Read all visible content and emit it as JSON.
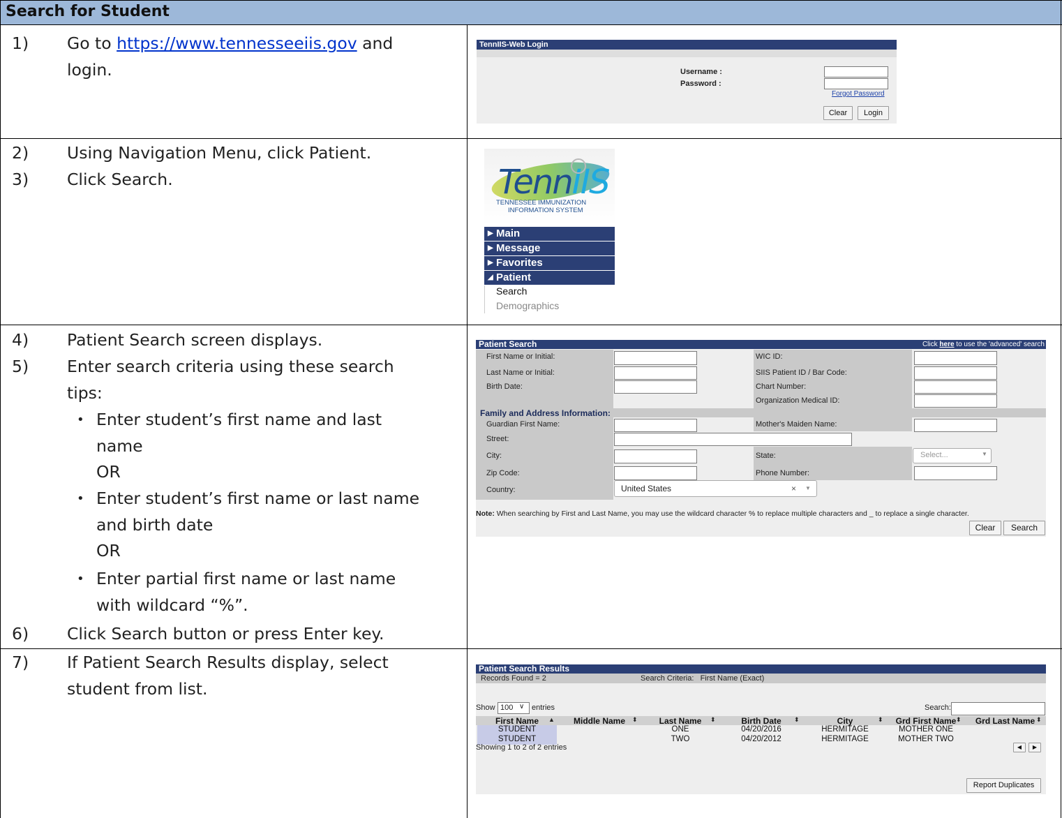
{
  "header": {
    "title": "Search for Student"
  },
  "steps": [
    {
      "num": "1)",
      "text_before_link": "Go to ",
      "link": "https://www.tennesseeiis.gov",
      "text_after_link": " and",
      "line2": "login."
    },
    {
      "num": "2)",
      "text": "Using Navigation Menu, click Patient."
    },
    {
      "num": "3)",
      "text": "Click Search."
    },
    {
      "num": "4)",
      "text": "Patient Search screen displays."
    },
    {
      "num": "5)",
      "line1": "Enter search criteria using these search",
      "line2": "tips:"
    },
    {
      "num": "6)",
      "text": "Click Search button or press Enter key."
    },
    {
      "num": "7)",
      "line1": "If Patient Search Results display, select",
      "line2": "student from list."
    }
  ],
  "tips": [
    {
      "line1": "Enter student’s first name and last",
      "line2": "name",
      "sep": "OR"
    },
    {
      "line1": "Enter student’s first name or last name",
      "line2": "and birth date",
      "sep": "OR"
    },
    {
      "line1": "Enter partial first name or last name",
      "line2": "with wildcard “%”."
    }
  ],
  "login": {
    "title": "TennIIS-Web Login",
    "username_label": "Username :",
    "password_label": "Password :",
    "forgot": "Forgot Password",
    "clear": "Clear",
    "login": "Login"
  },
  "nav": {
    "logo_text": "Tenn",
    "logo_suffix": "IIS",
    "logo_line1": "TENNESSEE IMMUNIZATION",
    "logo_line2": "INFORMATION SYSTEM",
    "items": [
      "Main",
      "Message",
      "Favorites",
      "Patient"
    ],
    "sub_items": [
      "Search",
      "Demographics"
    ]
  },
  "patient_search": {
    "title": "Patient Search",
    "advanced_prefix": "Click ",
    "advanced_link": "here",
    "advanced_suffix": " to use the 'advanced' search",
    "first_name": "First Name or Initial:",
    "last_name": "Last Name or Initial:",
    "birth_date": "Birth Date:",
    "wic": "WIC ID:",
    "siis": "SIIS Patient ID / Bar Code:",
    "chart": "Chart Number:",
    "org": "Organization Medical ID:",
    "family_header": "Family and Address Information:",
    "guardian": "Guardian First Name:",
    "maiden": "Mother's Maiden Name:",
    "street": "Street:",
    "city": "City:",
    "state": "State:",
    "state_placeholder": "Select...",
    "zip": "Zip Code:",
    "phone": "Phone Number:",
    "country": "Country:",
    "country_value": "United States",
    "note_label": "Note:",
    "note_text": "When searching by First and Last Name, you may use the wildcard character % to replace multiple characters and _ to replace a single character.",
    "clear": "Clear",
    "search": "Search"
  },
  "results": {
    "title": "Patient Search Results",
    "records": "Records Found = 2",
    "criteria": "Search Criteria:   First Name (Exact)",
    "show": "Show",
    "entries_value": "100",
    "entries": "entries",
    "search_label": "Search:",
    "columns": [
      "First Name",
      "Middle Name",
      "Last Name",
      "Birth Date",
      "City",
      "Grd First Name",
      "Grd Last Name"
    ],
    "rows": [
      [
        "STUDENT",
        "",
        "ONE",
        "04/20/2016",
        "HERMITAGE",
        "MOTHER ONE",
        ""
      ],
      [
        "STUDENT",
        "",
        "TWO",
        "04/20/2012",
        "HERMITAGE",
        "MOTHER TWO",
        ""
      ]
    ],
    "showing": "Showing 1 to 2 of 2 entries",
    "report": "Report Duplicates"
  }
}
